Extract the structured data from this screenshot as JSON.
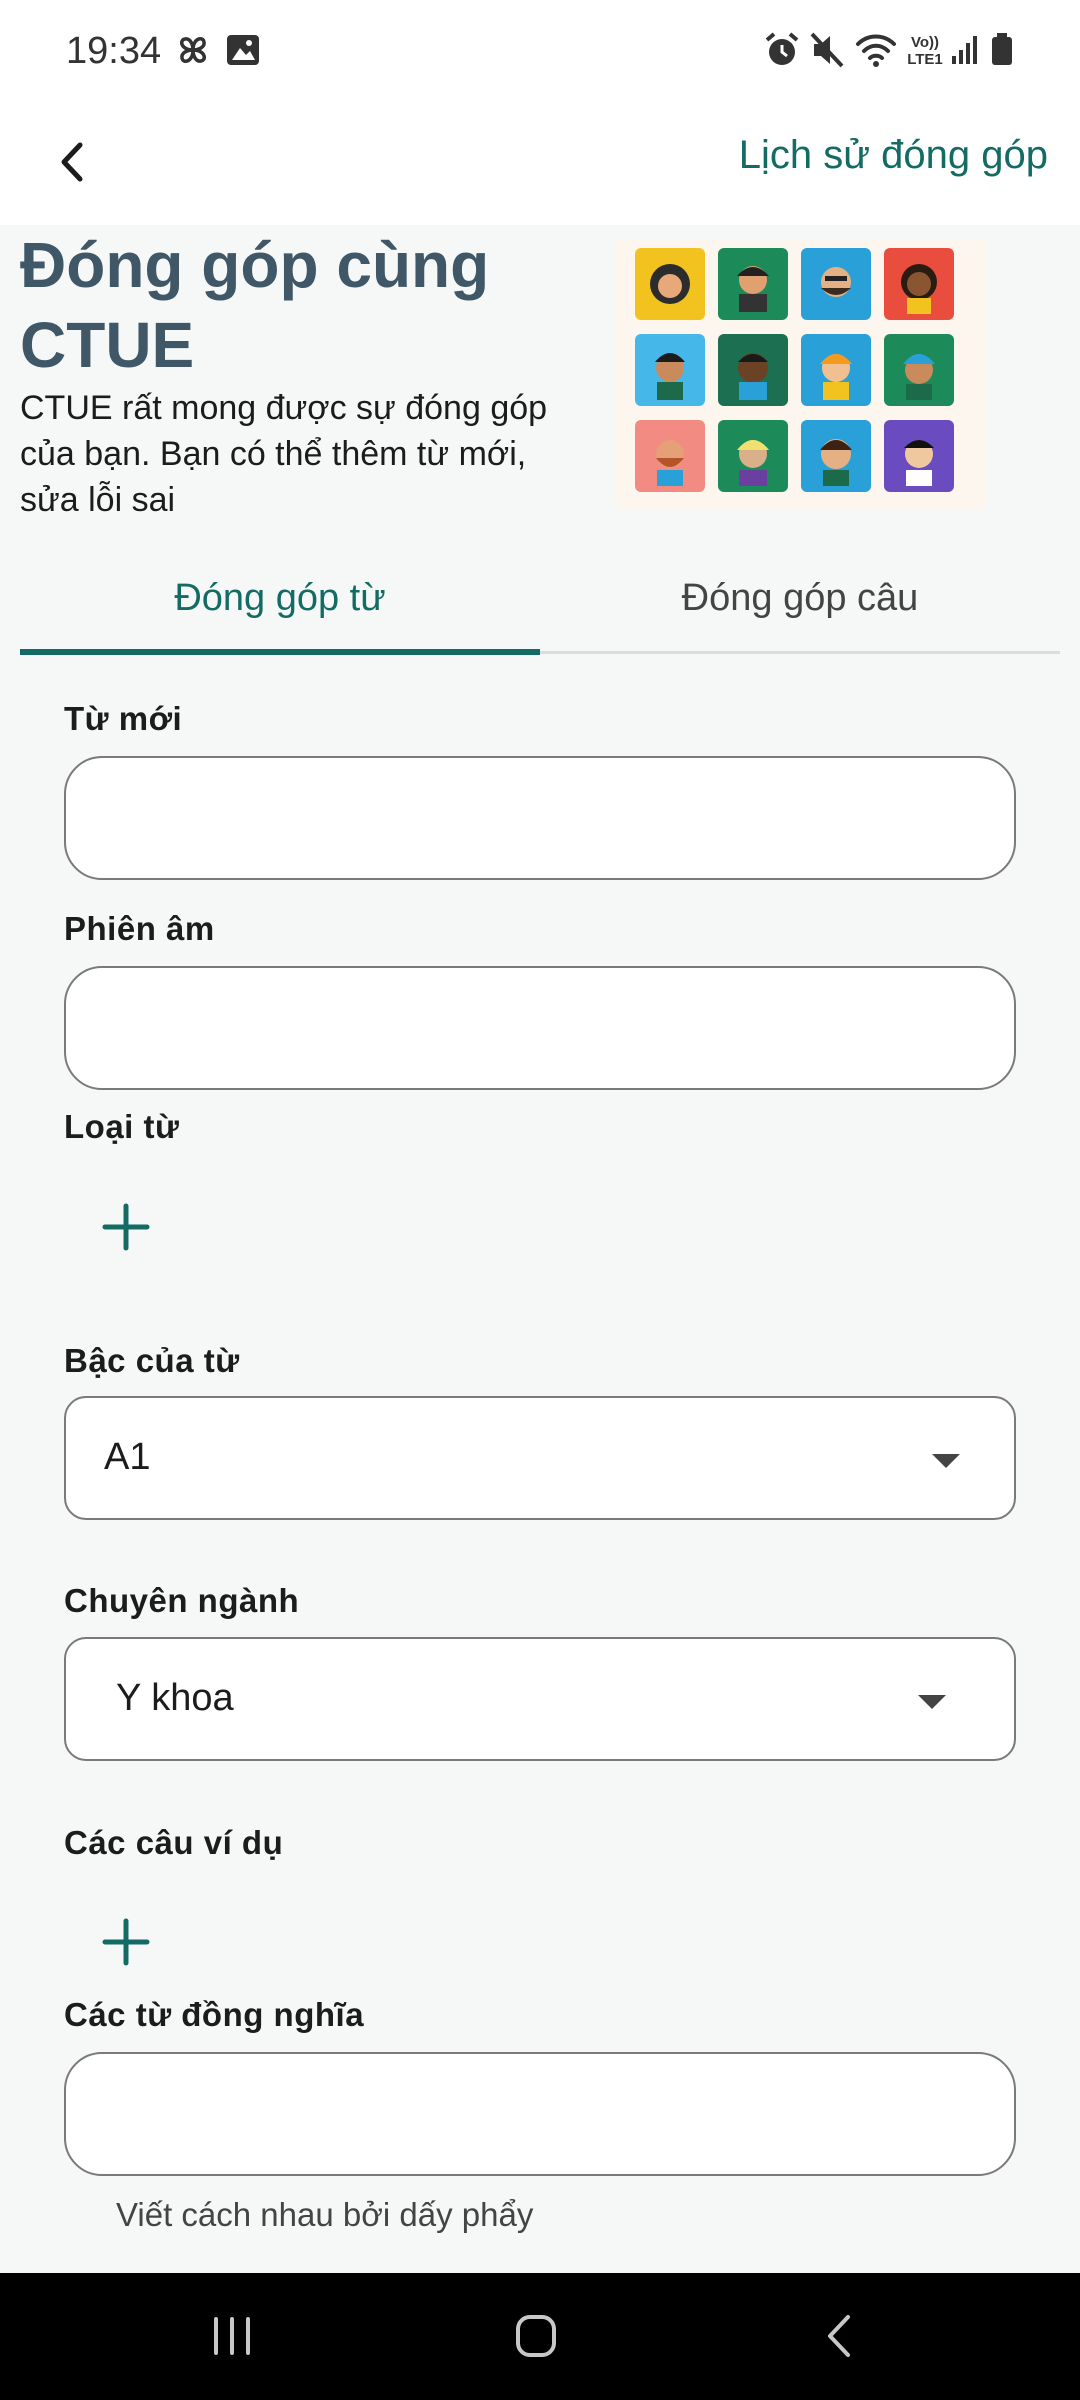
{
  "status_bar": {
    "time": "19:34",
    "icons": [
      "pinwheel-icon",
      "image-icon",
      "alarm-icon",
      "mute-icon",
      "wifi-icon",
      "volte-icon",
      "signal-icon",
      "battery-icon"
    ],
    "volte_text": "Vo)) LTE1"
  },
  "app_bar": {
    "back_icon": "chevron-left-icon",
    "history_label": "Lịch sử đóng góp"
  },
  "hero": {
    "title": "Đóng góp cùng CTUE",
    "description": "CTUE rất mong được sự đóng góp của bạn. Bạn có thể thêm từ mới, sửa lỗi sai",
    "image": "community-puzzle-illustration"
  },
  "tabs": [
    {
      "label": "Đóng góp từ",
      "active": true
    },
    {
      "label": "Đóng góp câu",
      "active": false
    }
  ],
  "form": {
    "new_word": {
      "label": "Từ mới",
      "value": ""
    },
    "phonetic": {
      "label": "Phiên âm",
      "value": ""
    },
    "word_type": {
      "label": "Loại từ",
      "add_icon": "plus-icon"
    },
    "level": {
      "label": "Bậc của từ",
      "value": "A1"
    },
    "major": {
      "label": "Chuyên ngành",
      "value": "Y khoa"
    },
    "examples": {
      "label": "Các câu ví dụ",
      "add_icon": "plus-icon"
    },
    "synonyms": {
      "label": "Các từ đồng nghĩa",
      "value": "",
      "helper": "Viết cách nhau bởi dấy phẩy"
    }
  },
  "colors": {
    "accent": "#136b63",
    "title": "#3f5766",
    "background": "#f6f8f8"
  },
  "nav_bar": {
    "buttons": [
      "recents-icon",
      "home-icon",
      "back-icon"
    ]
  }
}
